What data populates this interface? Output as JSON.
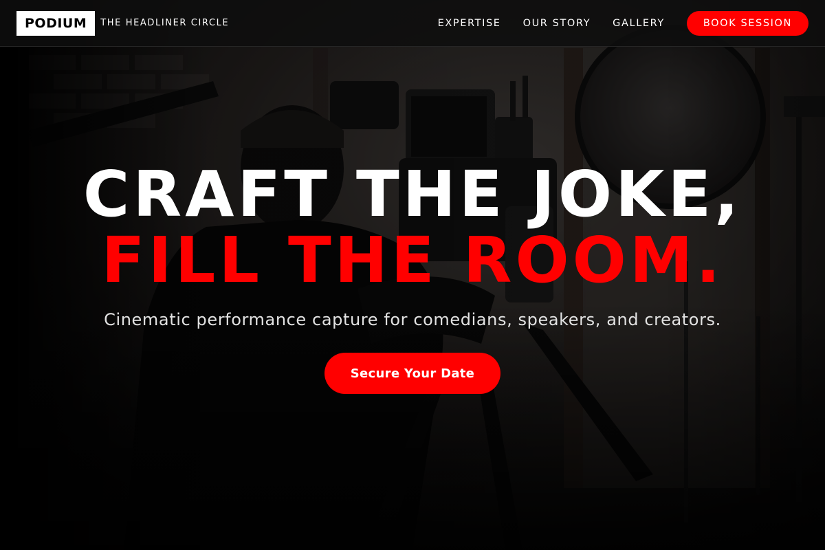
{
  "header": {
    "logo": "PODIUM",
    "tagline": "THE HEADLINER CIRCLE",
    "nav": [
      {
        "label": "EXPERTISE"
      },
      {
        "label": "OUR STORY"
      },
      {
        "label": "GALLERY"
      }
    ],
    "cta_label": "BOOK SESSION"
  },
  "hero": {
    "headline_line1": "CRAFT THE JOKE,",
    "headline_line2": "FILL THE ROOM.",
    "subheadline": "Cinematic performance capture for comedians, speakers, and creators.",
    "cta_label": "Secure Your Date"
  },
  "colors": {
    "accent": "#ff0000",
    "background": "#000000",
    "text_primary": "#ffffff",
    "text_secondary": "#e2e2e2"
  }
}
